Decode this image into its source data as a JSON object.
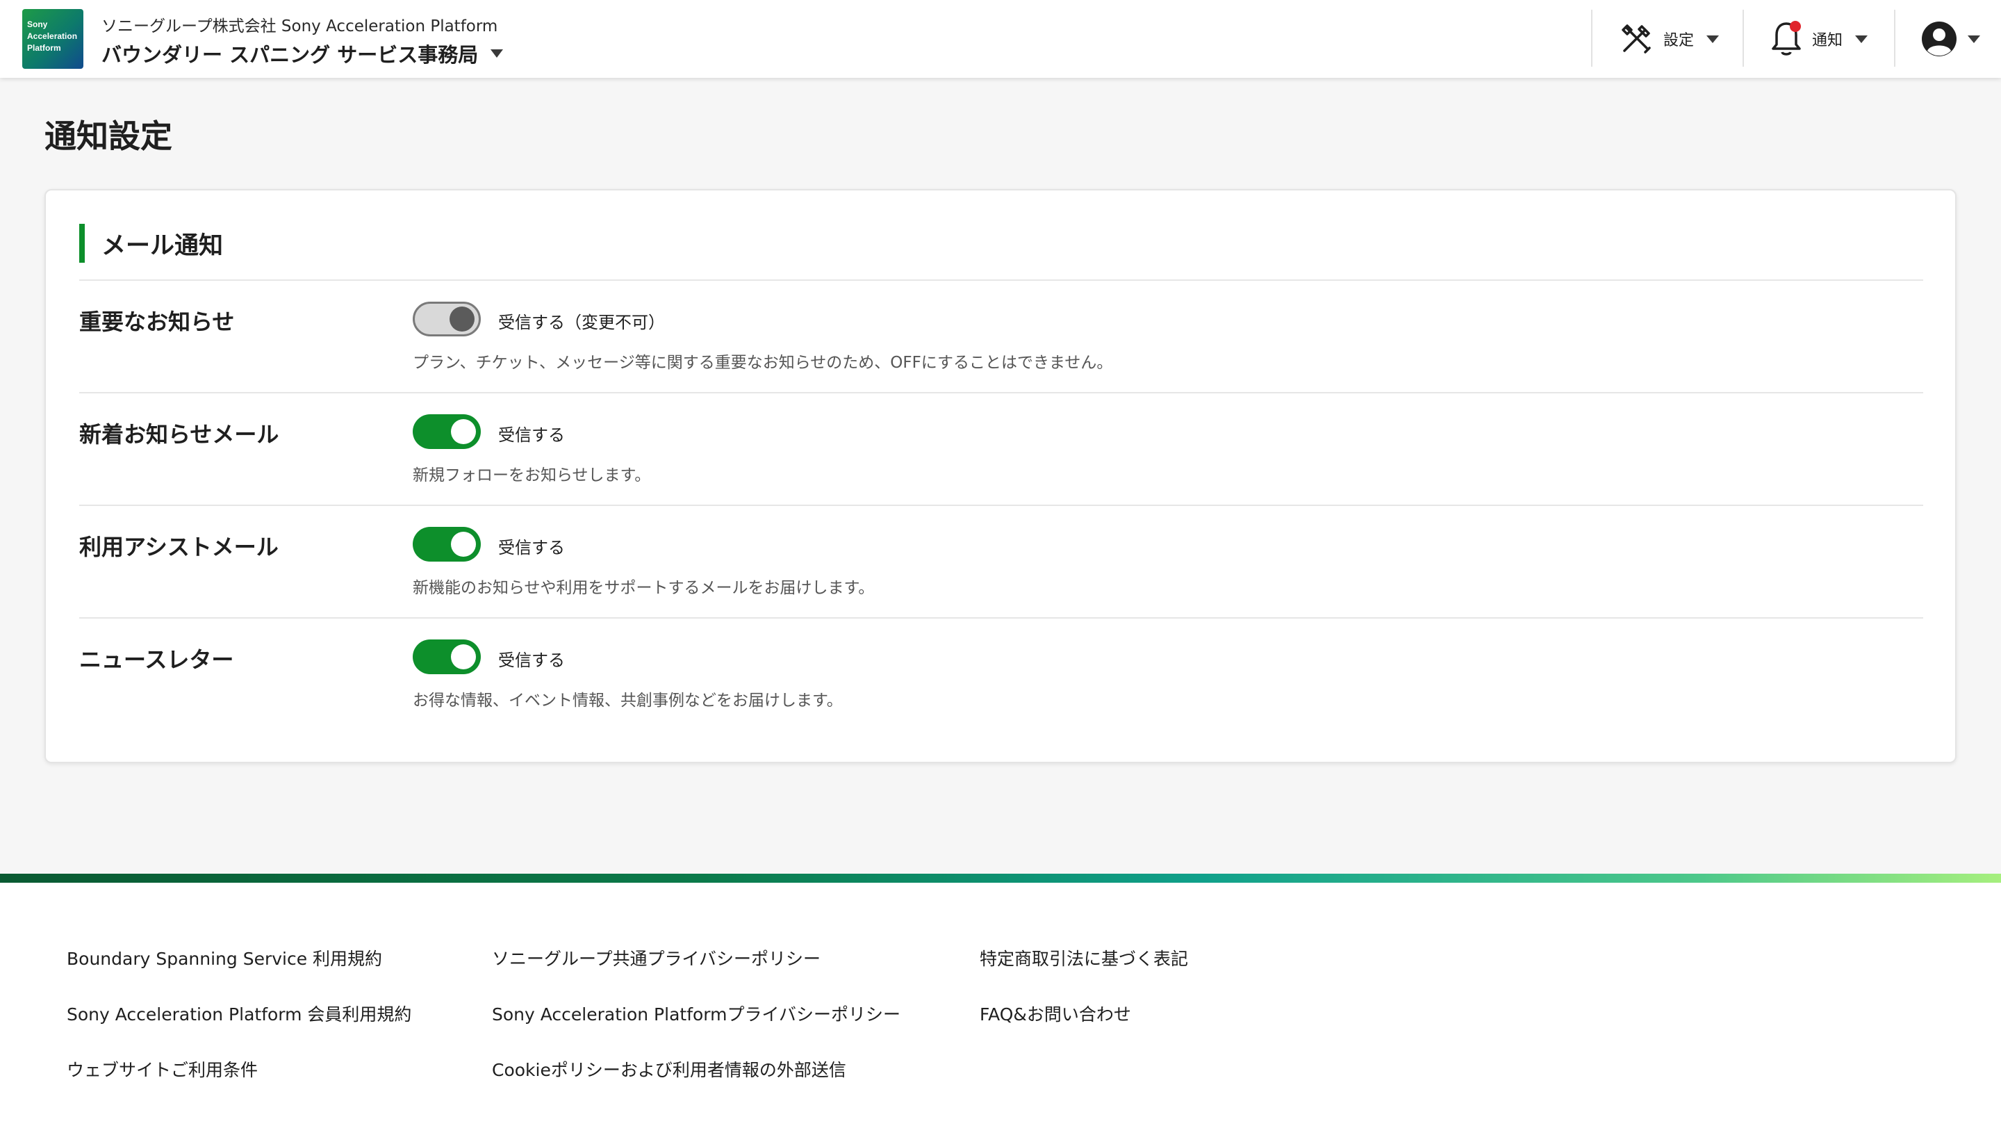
{
  "header": {
    "logo_lines": [
      "Sony",
      "Acceleration",
      "Platform"
    ],
    "org_line": "ソニーグループ株式会社 Sony Acceleration Platform",
    "office_title": "バウンダリー スパニング サービス事務局",
    "settings_label": "設定",
    "notifications_label": "通知",
    "notification_badge_color": "#e0242b"
  },
  "page": {
    "title": "通知設定"
  },
  "section": {
    "title": "メール通知",
    "accent_color": "#0d8f2b"
  },
  "settings": [
    {
      "label": "重要なお知らせ",
      "toggle_text": "受信する（変更不可）",
      "description": "プラン、チケット、メッセージ等に関する重要なお知らせのため、OFFにすることはできません。",
      "enabled": true,
      "locked": true
    },
    {
      "label": "新着お知らせメール",
      "toggle_text": "受信する",
      "description": "新規フォローをお知らせします。",
      "enabled": true,
      "locked": false
    },
    {
      "label": "利用アシストメール",
      "toggle_text": "受信する",
      "description": "新機能のお知らせや利用をサポートするメールをお届けします。",
      "enabled": true,
      "locked": false
    },
    {
      "label": "ニュースレター",
      "toggle_text": "受信する",
      "description": "お得な情報、イベント情報、共創事例などをお届けします。",
      "enabled": true,
      "locked": false
    }
  ],
  "footer": {
    "links": [
      [
        "Boundary Spanning Service 利用規約",
        "Sony Acceleration Platform 会員利用規約",
        "ウェブサイトご利用条件"
      ],
      [
        "ソニーグループ共通プライバシーポリシー",
        "Sony Acceleration Platformプライバシーポリシー",
        "Cookieポリシーおよび利用者情報の外部送信"
      ],
      [
        "特定商取引法に基づく表記",
        "FAQ&お問い合わせ"
      ]
    ]
  }
}
